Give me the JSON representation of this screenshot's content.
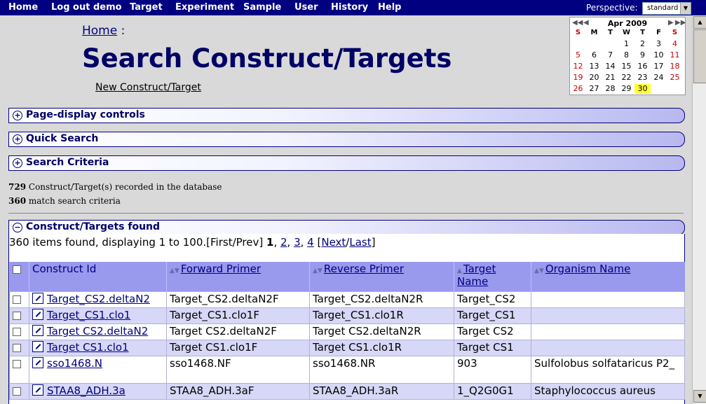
{
  "menu": [
    "Home",
    "Log out demo",
    "Target",
    "Experiment",
    "Sample",
    "User",
    "History",
    "Help"
  ],
  "perspective": {
    "label": "Perspective:",
    "value": "standard"
  },
  "breadcrumb": {
    "home": "Home",
    "sep": ":"
  },
  "title": "Search Construct/Targets",
  "new_link": "New Construct/Target",
  "calendar": {
    "title": "Apr 2009",
    "dow": [
      "S",
      "M",
      "T",
      "W",
      "T",
      "F",
      "S"
    ],
    "weeks": [
      [
        "",
        "",
        "",
        "1",
        "2",
        "3",
        "4"
      ],
      [
        "5",
        "6",
        "7",
        "8",
        "9",
        "10",
        "11"
      ],
      [
        "12",
        "13",
        "14",
        "15",
        "16",
        "17",
        "18"
      ],
      [
        "19",
        "20",
        "21",
        "22",
        "23",
        "24",
        "25"
      ],
      [
        "26",
        "27",
        "28",
        "29",
        "30",
        "",
        ""
      ]
    ],
    "today": "30"
  },
  "sections": [
    "Page-display controls",
    "Quick Search",
    "Search Criteria"
  ],
  "stats": {
    "total": "729",
    "total_text": "Construct/Target(s) recorded in the database",
    "matched": "360",
    "matched_text": "match search criteria"
  },
  "results": {
    "heading": "Construct/Targets found",
    "pager_text": "360 items found, displaying 1 to 100.[First/Prev]",
    "pages": [
      "1",
      "2",
      "3",
      "4"
    ],
    "next": "Next",
    "last": "Last",
    "columns": [
      "Construct Id",
      "Forward Primer",
      "Reverse Primer",
      "Target Name",
      "Organism Name"
    ],
    "rows": [
      {
        "id": "Target_CS2.deltaN2",
        "fwd": "Target_CS2.deltaN2F",
        "rev": "Target_CS2.deltaN2R",
        "target": "Target_CS2",
        "org": ""
      },
      {
        "id": "Target_CS1.clo1",
        "fwd": "Target_CS1.clo1F",
        "rev": "Target_CS1.clo1R",
        "target": "Target_CS1",
        "org": ""
      },
      {
        "id": "Target CS2.deltaN2",
        "fwd": "Target CS2.deltaN2F",
        "rev": "Target CS2.deltaN2R",
        "target": "Target CS2",
        "org": ""
      },
      {
        "id": "Target CS1.clo1",
        "fwd": "Target CS1.clo1F",
        "rev": "Target CS1.clo1R",
        "target": "Target CS1",
        "org": ""
      },
      {
        "id": "sso1468.N",
        "fwd": "sso1468.NF",
        "rev": "sso1468.NR",
        "target": "903",
        "org": "Sulfolobus solfataricus P2_"
      },
      {
        "id": "STAA8_ADH.3a",
        "fwd": "STAA8_ADH.3aF",
        "rev": "STAA8_ADH.3aR",
        "target": "1_Q2G0G1",
        "org": "Staphylococcus aureus"
      }
    ]
  }
}
